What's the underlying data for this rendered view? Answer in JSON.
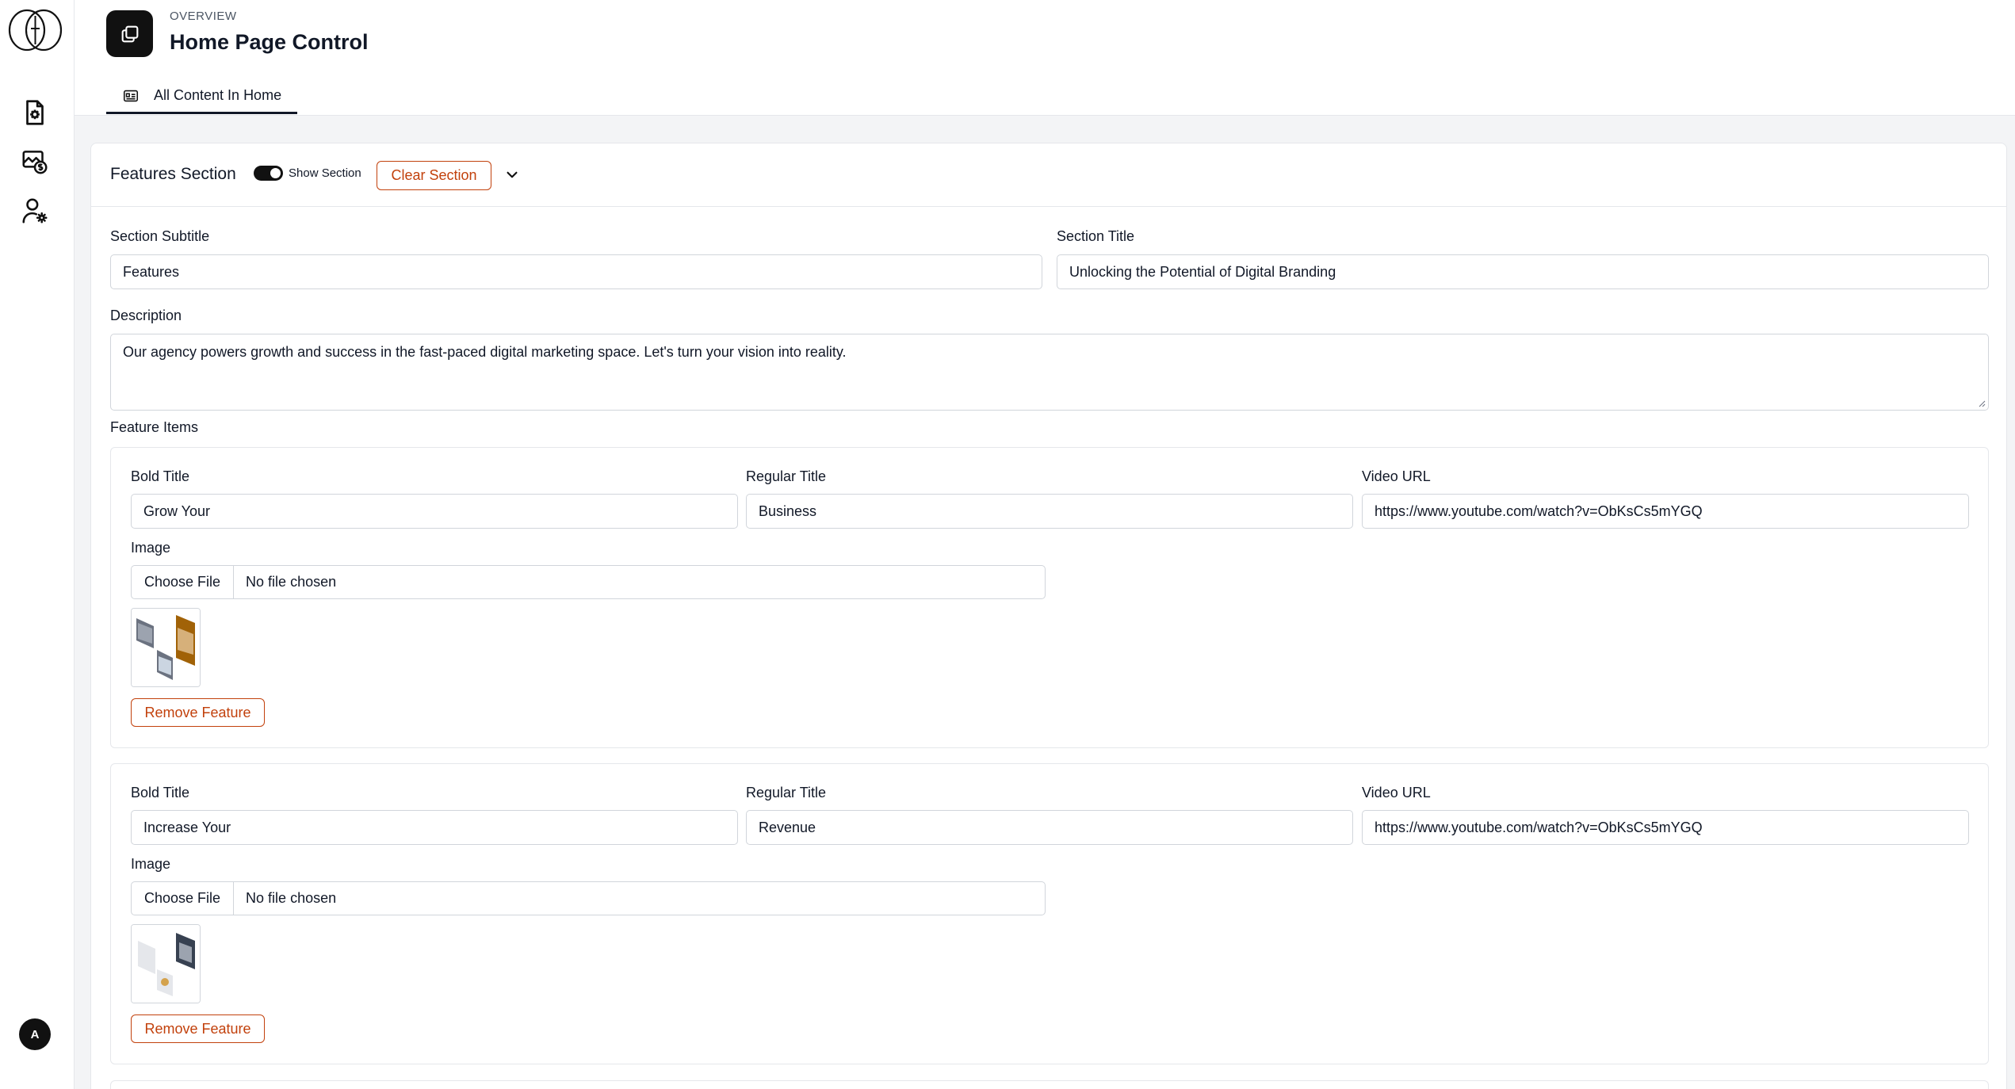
{
  "sidebar": {
    "items": [
      {
        "icon": "document-settings-icon"
      },
      {
        "icon": "money-image-icon"
      },
      {
        "icon": "user-settings-icon"
      }
    ],
    "avatar_initial": "A"
  },
  "header": {
    "overline": "OVERVIEW",
    "title": "Home Page Control",
    "tab_label": "All Content In Home"
  },
  "section": {
    "name": "Features Section",
    "show_label": "Show Section",
    "show_enabled": true,
    "clear_label": "Clear Section",
    "subtitle_label": "Section Subtitle",
    "subtitle_value": "Features",
    "title_label": "Section Title",
    "title_value": "Unlocking the Potential of Digital Branding",
    "description_label": "Description",
    "description_value": "Our agency powers growth and success in the fast-paced digital marketing space. Let's turn your vision into reality.",
    "items_label": "Feature Items"
  },
  "feature_labels": {
    "bold_title": "Bold Title",
    "regular_title": "Regular Title",
    "video_url": "Video URL",
    "image": "Image",
    "choose_file": "Choose File",
    "no_file": "No file chosen",
    "remove": "Remove Feature"
  },
  "features": [
    {
      "bold_title": "Grow Your",
      "regular_title": "Business",
      "video_url": "https://www.youtube.com/watch?v=ObKsCs5mYGQ"
    },
    {
      "bold_title": "Increase Your",
      "regular_title": "Revenue",
      "video_url": "https://www.youtube.com/watch?v=ObKsCs5mYGQ"
    }
  ],
  "colors": {
    "accent": "#c2410c",
    "dark": "#111111",
    "border": "#d1d5db"
  }
}
